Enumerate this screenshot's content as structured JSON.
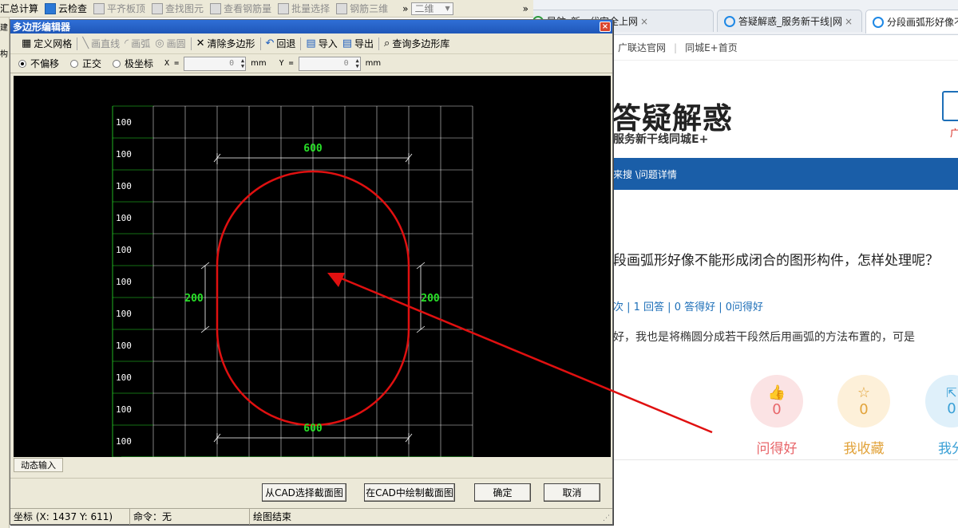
{
  "app_toolbar": {
    "items": [
      {
        "label": "汇总计算",
        "enabled": true
      },
      {
        "label": "云检查",
        "enabled": true
      },
      {
        "label": "平齐板顶",
        "enabled": false
      },
      {
        "label": "查找图元",
        "enabled": false
      },
      {
        "label": "查看钢筋量",
        "enabled": false
      },
      {
        "label": "批量选择",
        "enabled": false
      },
      {
        "label": "钢筋三维",
        "enabled": false
      }
    ],
    "view_mode": "二维",
    "more_1": "»",
    "more_2": "»"
  },
  "left_strip": {
    "text_1": "建",
    "text_2": "构"
  },
  "browser": {
    "tabs": [
      {
        "label": "导航_新一代安全上网"
      },
      {
        "label": "答疑解惑_服务新干线|网"
      },
      {
        "label": "分段画弧形好像不"
      }
    ],
    "tab_close": "×",
    "bookmarks": [
      "广联达官网",
      "同城E+首页"
    ],
    "bookmark_sep": "|",
    "logo": "答疑解惑",
    "slogan": "服务新干线同城E+",
    "search_hint": "广",
    "nav_breadcrumb": "来搜 \\问题详情",
    "question_title": "段画弧形好像不能形成闭合的图形构件，怎样处理呢？",
    "question_stats": "次 | 1 回答 | 0 答得好 | 0问得好",
    "question_body": "好，我也是将椭圆分成若干段然后用画弧的方法布置的，可是",
    "actions": [
      {
        "count": "0",
        "label": "问得好",
        "color": "#e8666a",
        "bg": "#fbe3e4"
      },
      {
        "count": "0",
        "label": "我收藏",
        "color": "#e2a33a",
        "bg": "#fdf0d9"
      },
      {
        "count": "0",
        "label": "我分",
        "color": "#3aa0d6",
        "bg": "#dff0fa"
      }
    ]
  },
  "dialog": {
    "title": "多边形编辑器",
    "close": "×",
    "toolbar": {
      "define_grid": "定义网格",
      "draw_line": "画直线",
      "draw_arc": "画弧",
      "draw_circle": "画圆",
      "clear_polygon": "清除多边形",
      "undo": "回退",
      "import": "导入",
      "export": "导出",
      "query_library": "查询多边形库"
    },
    "coord": {
      "radio_no_offset": "不偏移",
      "radio_ortho": "正交",
      "radio_polar": "极坐标",
      "x_label": "X =",
      "x_value": "0",
      "x_unit": "mm",
      "y_label": "Y =",
      "y_value": "0",
      "y_unit": "mm"
    },
    "drawing": {
      "row_label": "100",
      "col_label": "100",
      "dim_top": "600",
      "dim_bottom": "600",
      "dim_left": "200",
      "dim_right": "200",
      "grid_color": "#ffffff",
      "dim_color": "#28e028",
      "shape_color": "#e01010"
    },
    "dynamic_input": "动态输入",
    "buttons": {
      "select_cad": "从CAD选择截面图",
      "draw_cad": "在CAD中绘制截面图",
      "ok": "确定",
      "cancel": "取消"
    },
    "status": {
      "coords": "坐标 (X: 1437 Y: 611)",
      "command": "命令：无",
      "message": "绘图结束"
    }
  },
  "annotation_arrow_color": "#e01010"
}
